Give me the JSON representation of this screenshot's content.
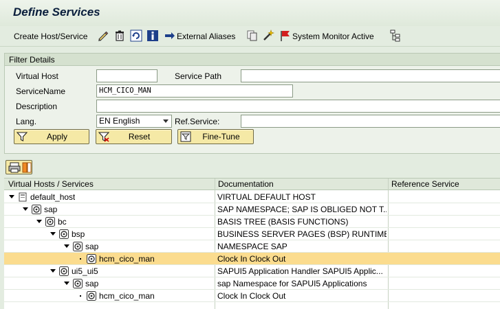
{
  "title": "Define Services",
  "toolbar": {
    "create": "Create Host/Service",
    "external_aliases": "External Aliases",
    "system_monitor": "System Monitor Active"
  },
  "filter": {
    "header": "Filter Details",
    "virtual_host_label": "Virtual Host",
    "virtual_host_value": "",
    "service_path_label": "Service Path",
    "service_path_value": "",
    "service_name_label": "ServiceName",
    "service_name_value": "HCM_CICO_MAN",
    "description_label": "Description",
    "description_value": "",
    "lang_label": "Lang.",
    "lang_value": "EN English",
    "ref_service_label": "Ref.Service:",
    "ref_service_value": "",
    "apply": "Apply",
    "reset": "Reset",
    "fine_tune": "Fine-Tune"
  },
  "tree": {
    "columns": [
      "Virtual Hosts / Services",
      "Documentation",
      "Reference Service"
    ],
    "rows": [
      {
        "name": "default_host",
        "doc": "VIRTUAL DEFAULT HOST",
        "ref": "",
        "level": 0,
        "icon": "host-icon",
        "expanded": true,
        "selected": false
      },
      {
        "name": "sap",
        "doc": "SAP NAMESPACE; SAP IS OBLIGED NOT T...",
        "ref": "",
        "level": 1,
        "icon": "service-node-icon",
        "expanded": true,
        "selected": false
      },
      {
        "name": "bc",
        "doc": "BASIS TREE (BASIS FUNCTIONS)",
        "ref": "",
        "level": 2,
        "icon": "service-node-icon",
        "expanded": true,
        "selected": false
      },
      {
        "name": "bsp",
        "doc": "BUSINESS SERVER PAGES (BSP) RUNTIME",
        "ref": "",
        "level": 3,
        "icon": "service-node-icon",
        "expanded": true,
        "selected": false
      },
      {
        "name": "sap",
        "doc": "NAMESPACE SAP",
        "ref": "",
        "level": 4,
        "icon": "service-node-icon",
        "expanded": true,
        "selected": false
      },
      {
        "name": "hcm_cico_man",
        "doc": "Clock In Clock Out",
        "ref": "",
        "level": 5,
        "icon": "service-leaf-icon",
        "expanded": false,
        "selected": true
      },
      {
        "name": "ui5_ui5",
        "doc": "SAPUI5 Application Handler SAPUI5 Applic...",
        "ref": "",
        "level": 3,
        "icon": "service-node-icon",
        "expanded": true,
        "selected": false
      },
      {
        "name": "sap",
        "doc": "sap Namespace for SAPUI5 Applications",
        "ref": "",
        "level": 4,
        "icon": "service-node-icon",
        "expanded": true,
        "selected": false
      },
      {
        "name": "hcm_cico_man",
        "doc": "Clock In Clock Out",
        "ref": "",
        "level": 5,
        "icon": "service-leaf-icon",
        "expanded": false,
        "selected": false
      }
    ]
  }
}
